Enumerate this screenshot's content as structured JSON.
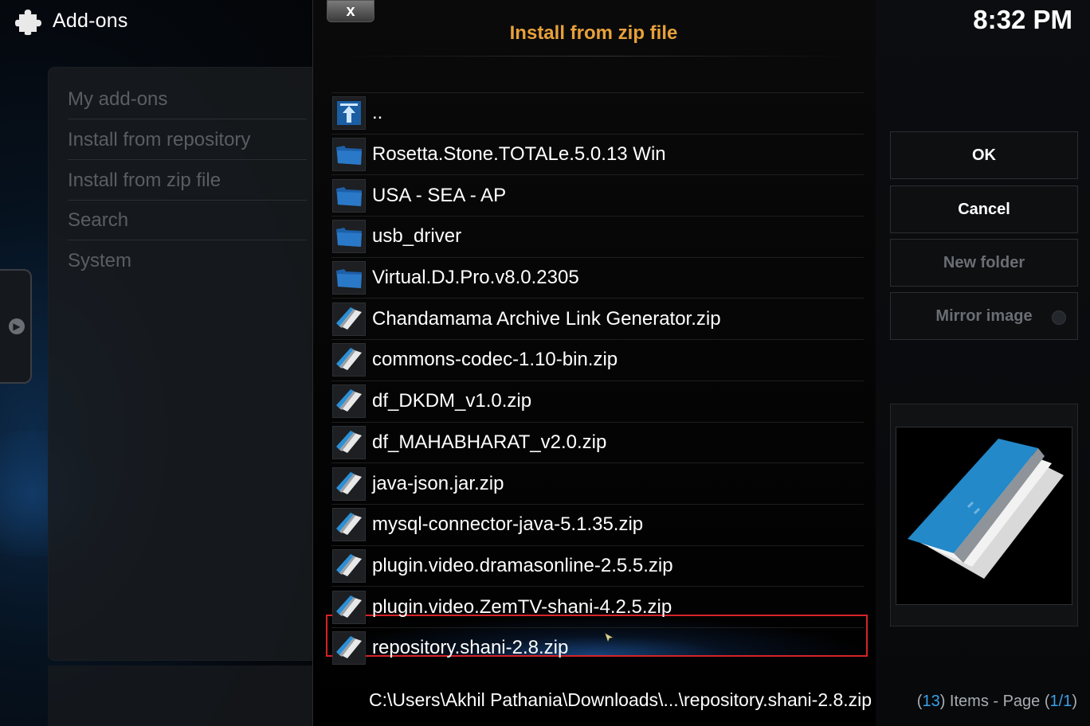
{
  "header": {
    "app_title": "Add-ons",
    "clock": "8:32 PM"
  },
  "sidebar": {
    "items": [
      {
        "label": "My add-ons"
      },
      {
        "label": "Install from repository"
      },
      {
        "label": "Install from zip file"
      },
      {
        "label": "Search"
      },
      {
        "label": "System"
      }
    ]
  },
  "dialog": {
    "close_label": "x",
    "title": "Install from zip file",
    "files": [
      {
        "name": "..",
        "icon": "parent-folder-icon"
      },
      {
        "name": "Rosetta.Stone.TOTALe.5.0.13 Win",
        "icon": "folder-icon"
      },
      {
        "name": "USA - SEA - AP",
        "icon": "folder-icon"
      },
      {
        "name": "usb_driver",
        "icon": "folder-icon"
      },
      {
        "name": "Virtual.DJ.Pro.v8.0.2305",
        "icon": "folder-icon"
      },
      {
        "name": "Chandamama Archive Link Generator.zip",
        "icon": "zip-file-icon"
      },
      {
        "name": "commons-codec-1.10-bin.zip",
        "icon": "zip-file-icon"
      },
      {
        "name": "df_DKDM_v1.0.zip",
        "icon": "zip-file-icon"
      },
      {
        "name": "df_MAHABHARAT_v2.0.zip",
        "icon": "zip-file-icon"
      },
      {
        "name": "java-json.jar.zip",
        "icon": "zip-file-icon"
      },
      {
        "name": "mysql-connector-java-5.1.35.zip",
        "icon": "zip-file-icon"
      },
      {
        "name": "plugin.video.dramasonline-2.5.5.zip",
        "icon": "zip-file-icon"
      },
      {
        "name": "plugin.video.ZemTV-shani-4.2.5.zip",
        "icon": "zip-file-icon"
      },
      {
        "name": "repository.shani-2.8.zip",
        "icon": "zip-file-icon",
        "selected": true
      }
    ],
    "path": "C:\\Users\\Akhil Pathania\\Downloads\\...\\repository.shani-2.8.zip",
    "items_count": {
      "open_paren": "(",
      "count": "13",
      "mid": ") Items - Page (",
      "page": "1/1",
      "close_paren": ")"
    }
  },
  "buttons": {
    "ok": "OK",
    "cancel": "Cancel",
    "new_folder": "New folder",
    "mirror_image": "Mirror image"
  },
  "colors": {
    "accent_title": "#e8a13a",
    "selection_border": "#d6232a",
    "count_highlight": "#3aa0e8"
  }
}
